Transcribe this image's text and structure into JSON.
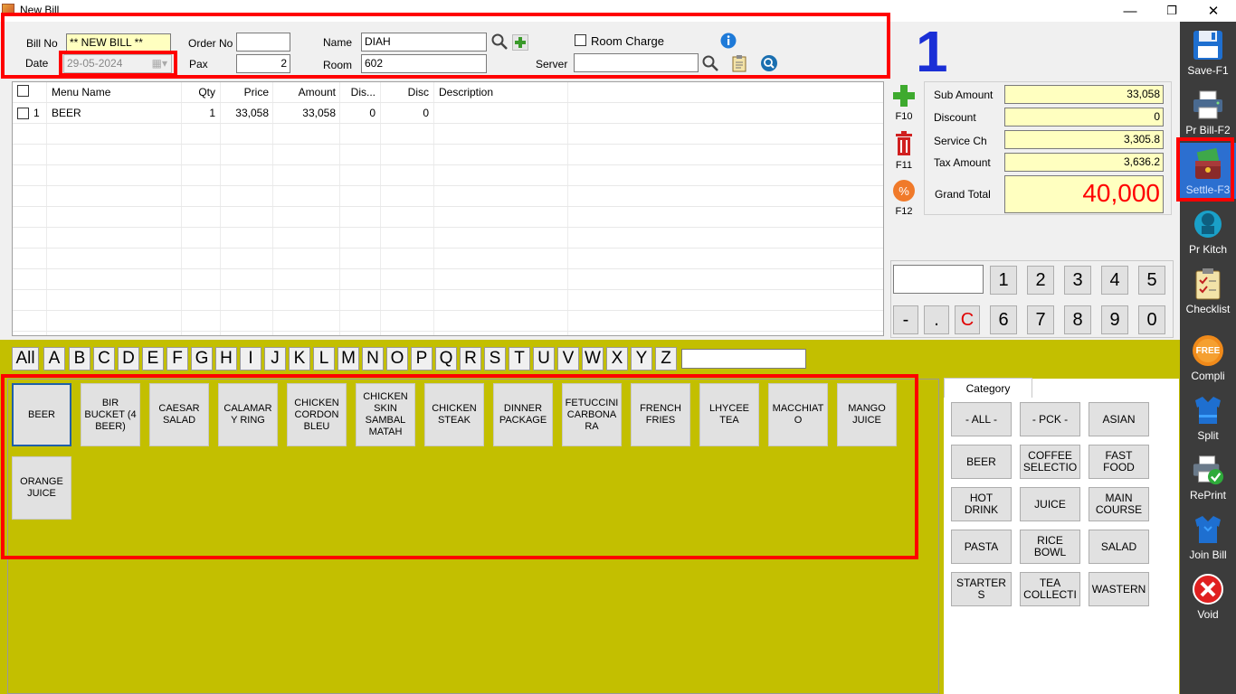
{
  "window": {
    "title": "New Bill",
    "minimize": "—",
    "maximize": "❐",
    "close": "✕"
  },
  "header": {
    "bill_no_label": "Bill No",
    "bill_no": "** NEW BILL **",
    "date_label": "Date",
    "date": "29-05-2024",
    "order_no_label": "Order No",
    "order_no": "",
    "pax_label": "Pax",
    "pax": "2",
    "name_label": "Name",
    "name": "DIAH",
    "room_label": "Room",
    "room": "602",
    "room_charge_label": "Room Charge",
    "server_label": "Server",
    "server": "",
    "table_number": "1"
  },
  "grid": {
    "columns": [
      "Menu Name",
      "Qty",
      "Price",
      "Amount",
      "Dis...",
      "Disc",
      "Description"
    ],
    "rows": [
      {
        "no": "1",
        "menu": "BEER",
        "qty": "1",
        "price": "33,058",
        "amount": "33,058",
        "dis": "0",
        "disc": "0",
        "desc": ""
      }
    ]
  },
  "side_actions": {
    "add": "F10",
    "delete": "F11",
    "discount": "F12"
  },
  "totals": {
    "sub_amount_label": "Sub Amount",
    "sub_amount": "33,058",
    "discount_label": "Discount",
    "discount": "0",
    "service_label": "Service Ch",
    "service": "3,305.8",
    "tax_label": "Tax Amount",
    "tax": "3,636.2",
    "grand_label": "Grand Total",
    "grand": "40,000"
  },
  "keypad": {
    "row1": [
      "1",
      "2",
      "3",
      "4",
      "5"
    ],
    "row2": [
      "-",
      ".",
      "C",
      "6",
      "7",
      "8",
      "9",
      "0"
    ]
  },
  "toolbar": [
    "Save-F1",
    "Pr Bill-F2",
    "Settle-F3",
    "Pr Kitch",
    "Checklist",
    "Compli",
    "Split",
    "RePrint",
    "Join Bill",
    "Void"
  ],
  "compli_badge": "FREE",
  "letters": [
    "All",
    "A",
    "B",
    "C",
    "D",
    "E",
    "F",
    "G",
    "H",
    "I",
    "J",
    "K",
    "L",
    "M",
    "N",
    "O",
    "P",
    "Q",
    "R",
    "S",
    "T",
    "U",
    "V",
    "W",
    "X",
    "Y",
    "Z"
  ],
  "menu_items": [
    "BEER",
    "BIR BUCKET (4 BEER)",
    "CAESAR SALAD",
    "CALAMAR Y RING",
    "CHICKEN CORDON BLEU",
    "CHICKEN SKIN SAMBAL MATAH",
    "CHICKEN STEAK",
    "DINNER PACKAGE",
    "FETUCCINI CARBONA RA",
    "FRENCH FRIES",
    "LHYCEE TEA",
    "MACCHIAT O",
    "MANGO JUICE",
    "ORANGE JUICE"
  ],
  "category": {
    "tab_label": "Category",
    "items": [
      "- ALL -",
      "- PCK -",
      "ASIAN",
      "BEER",
      "COFFEE SELECTIO",
      "FAST FOOD",
      "HOT DRINK",
      "JUICE",
      "MAIN COURSE",
      "PASTA",
      "RICE BOWL",
      "SALAD",
      "STARTER S",
      "TEA COLLECTI",
      "WASTERN"
    ]
  },
  "colors": {
    "accent_blue": "#1a2fd6",
    "grand_total_red": "#ff0000",
    "olive": "#c3bf00",
    "toolbar_dark": "#3c3c3c",
    "highlight_red": "#ff0000"
  }
}
